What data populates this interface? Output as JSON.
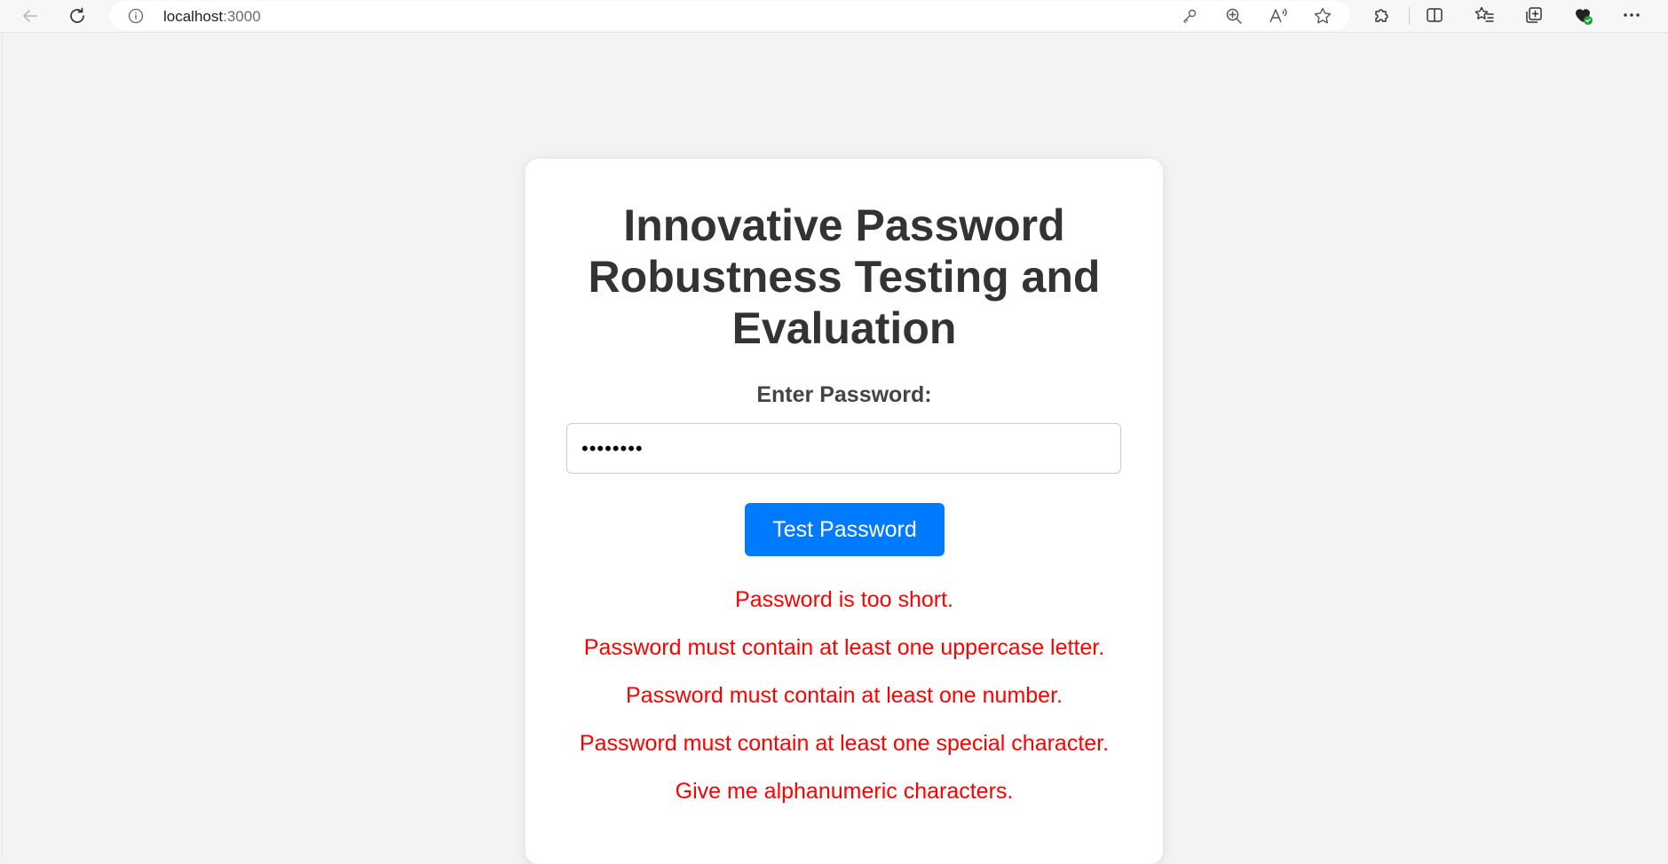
{
  "browser": {
    "url_host": "localhost",
    "url_port": ":3000",
    "icons": {
      "back": "back-arrow-icon",
      "reload": "reload-icon",
      "info": "info-icon",
      "key": "key-icon",
      "zoom": "zoom-in-icon",
      "read_aloud": "read-aloud-icon",
      "favorite": "star-icon",
      "extensions": "puzzle-icon",
      "split": "split-screen-icon",
      "favorites": "favorites-list-icon",
      "collections": "collections-icon",
      "health": "browser-essentials-icon",
      "more": "more-icon"
    }
  },
  "page": {
    "title": "Innovative Password Robustness Testing and Evaluation",
    "label": "Enter Password:",
    "password_value": "12345678",
    "button_label": "Test Password",
    "messages": [
      "Password is too short.",
      "Password must contain at least one uppercase letter.",
      "Password must contain at least one number.",
      "Password must contain at least one special character.",
      "Give me alphanumeric characters."
    ],
    "colors": {
      "accent": "#007bff",
      "error": "#ff0000",
      "heading": "#333333",
      "background": "#f3f3f3"
    }
  }
}
